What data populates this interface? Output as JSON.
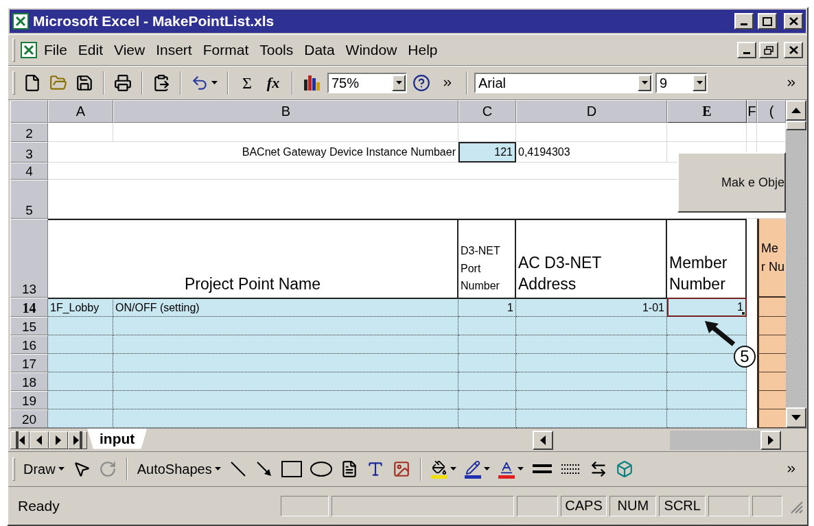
{
  "window": {
    "title": "Microsoft Excel - MakePointList.xls"
  },
  "menu": [
    {
      "label": "File"
    },
    {
      "label": "Edit"
    },
    {
      "label": "View"
    },
    {
      "label": "Insert"
    },
    {
      "label": "Format"
    },
    {
      "label": "Tools"
    },
    {
      "label": "Data"
    },
    {
      "label": "Window"
    },
    {
      "label": "Help"
    }
  ],
  "toolbar": {
    "sum": "Σ",
    "function": "fx",
    "zoom": "75%",
    "font": "Arial",
    "font_size": "9"
  },
  "sheet": {
    "columns": [
      {
        "label": "A",
        "selected": false
      },
      {
        "label": "B",
        "selected": false
      },
      {
        "label": "C",
        "selected": false
      },
      {
        "label": "D",
        "selected": false
      },
      {
        "label": "E",
        "selected": true
      },
      {
        "label": "F",
        "selected": false
      },
      {
        "label": "(",
        "selected": false
      }
    ],
    "rows": [
      {
        "label": "2",
        "kind": "blank",
        "selected": false
      },
      {
        "label": "3",
        "kind": "instance",
        "selected": false,
        "caption": "BACnet Gateway Device Instance Numbaer",
        "value": "121",
        "range": "0,4194303"
      },
      {
        "label": "4",
        "kind": "spacer",
        "selected": false
      },
      {
        "label": "5",
        "kind": "spacer",
        "selected": false
      },
      {
        "label": "13",
        "kind": "heading",
        "selected": false,
        "headings": [
          "Project Point Name",
          "D3-NET Port Number",
          "AC D3-NET Address",
          "Member Number"
        ],
        "side_heading": [
          "Me",
          "r Nu"
        ]
      },
      {
        "label": "14",
        "kind": "record",
        "selected": true,
        "cells": [
          "1F_Lobby",
          "ON/OFF (setting)",
          "1",
          "1-01",
          "1"
        ]
      },
      {
        "label": "15",
        "kind": "record",
        "selected": false
      },
      {
        "label": "16",
        "kind": "record",
        "selected": false
      },
      {
        "label": "17",
        "kind": "record",
        "selected": false
      },
      {
        "label": "18",
        "kind": "record",
        "selected": false
      },
      {
        "label": "19",
        "kind": "record",
        "selected": false
      },
      {
        "label": "20",
        "kind": "record",
        "selected": false
      }
    ],
    "button": "Mak e Obje",
    "callout": "5"
  },
  "sheet_tabs": [
    {
      "label": "input",
      "selected": true
    }
  ],
  "drawing_toolbar": {
    "draw": "Draw",
    "autoshapes": "AutoShapes"
  },
  "status_bar": {
    "text": "Ready",
    "indicators": [
      "CAPS",
      "NUM",
      "SCRL"
    ]
  }
}
